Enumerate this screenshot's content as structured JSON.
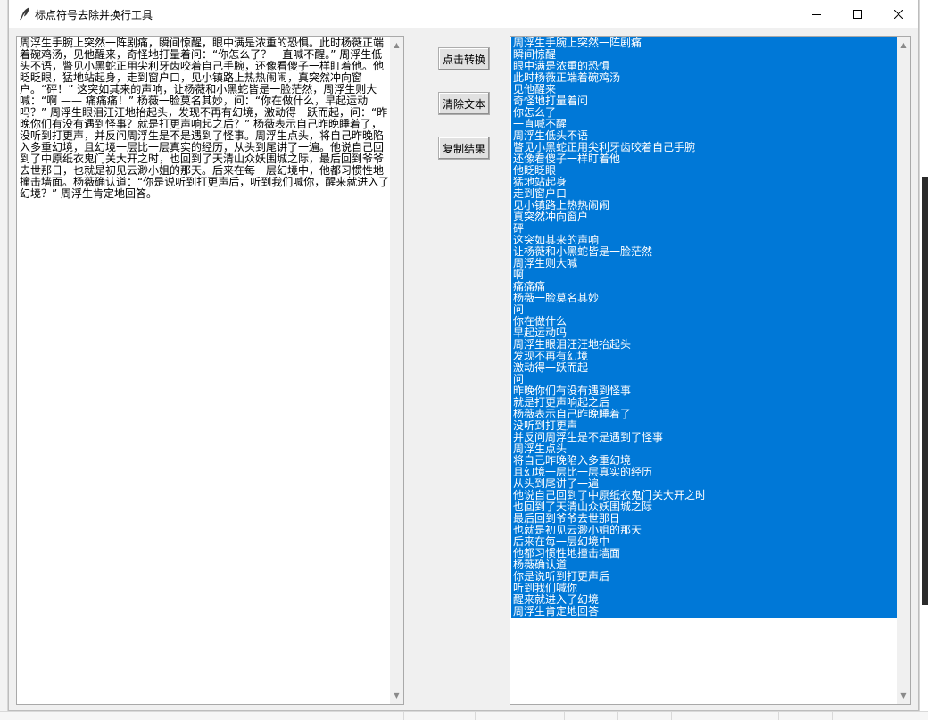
{
  "window": {
    "title": "标点符号去除并换行工具"
  },
  "buttons": {
    "convert": "点击转换",
    "clear": "清除文本",
    "copy": "复制结果"
  },
  "input_text": "周浮生手腕上突然一阵剧痛，瞬间惊醒，眼中满是浓重的恐惧。此时杨薇正端着碗鸡汤，见他醒来，奇怪地打量着问：“你怎么了？一直喊不醒。” 周浮生低头不语，瞥见小黑蛇正用尖利牙齿咬着自己手腕，还像看傻子一样盯着他。他眨眨眼，猛地站起身，走到窗户口，见小镇路上热热闹闹，真突然冲向窗户。“砰！” 这突如其来的声响，让杨薇和小黑蛇皆是一脸茫然，周浮生则大喊：“啊 —— 痛痛痛！” 杨薇一脸莫名其妙，问：“你在做什么，早起运动吗？” 周浮生眼泪汪汪地抬起头，发现不再有幻境，激动得一跃而起，问：“昨晚你们有没有遇到怪事？就是打更声响起之后？” 杨薇表示自己昨晚睡着了，没听到打更声，并反问周浮生是不是遇到了怪事。周浮生点头，将自己昨晚陷入多重幻境，且幻境一层比一层真实的经历，从头到尾讲了一遍。他说自己回到了中原纸衣鬼门关大开之时，也回到了天清山众妖围城之际，最后回到爷爷去世那日，也就是初见云渺小姐的那天。后来在每一层幻境中，他都习惯性地撞击墙面。杨薇确认道：“你是说听到打更声后，听到我们喊你，醒来就进入了幻境？” 周浮生肯定地回答。",
  "output_lines": [
    "周浮生手腕上突然一阵剧痛",
    "瞬间惊醒",
    "眼中满是浓重的恐惧",
    "此时杨薇正端着碗鸡汤",
    "见他醒来",
    "奇怪地打量着问",
    "你怎么了",
    "一直喊不醒",
    "周浮生低头不语",
    "瞥见小黑蛇正用尖利牙齿咬着自己手腕",
    "还像看傻子一样盯着他",
    "他眨眨眼",
    "猛地站起身",
    "走到窗户口",
    "见小镇路上热热闹闹",
    "真突然冲向窗户",
    "砰",
    "这突如其来的声响",
    "让杨薇和小黑蛇皆是一脸茫然",
    "周浮生则大喊",
    "啊",
    "痛痛痛",
    "杨薇一脸莫名其妙",
    "问",
    "你在做什么",
    "早起运动吗",
    "周浮生眼泪汪汪地抬起头",
    "发现不再有幻境",
    "激动得一跃而起",
    "问",
    "昨晚你们有没有遇到怪事",
    "就是打更声响起之后",
    "杨薇表示自己昨晚睡着了",
    "没听到打更声",
    "并反问周浮生是不是遇到了怪事",
    "周浮生点头",
    "将自己昨晚陷入多重幻境",
    "且幻境一层比一层真实的经历",
    "从头到尾讲了一遍",
    "他说自己回到了中原纸衣鬼门关大开之时",
    "也回到了天清山众妖围城之际",
    "最后回到爷爷去世那日",
    "也就是初见云渺小姐的那天",
    "后来在每一层幻境中",
    "他都习惯性地撞击墙面",
    "杨薇确认道",
    "你是说听到打更声后",
    "听到我们喊你",
    "醒来就进入了幻境",
    "周浮生肯定地回答"
  ],
  "icons": {
    "app": "feather-icon",
    "minimize": "minimize-icon",
    "maximize": "maximize-icon",
    "close": "close-icon"
  },
  "colors": {
    "selection": "#0078d7",
    "window_bg": "#f0f0f0",
    "button_bg": "#e1e1e1"
  }
}
